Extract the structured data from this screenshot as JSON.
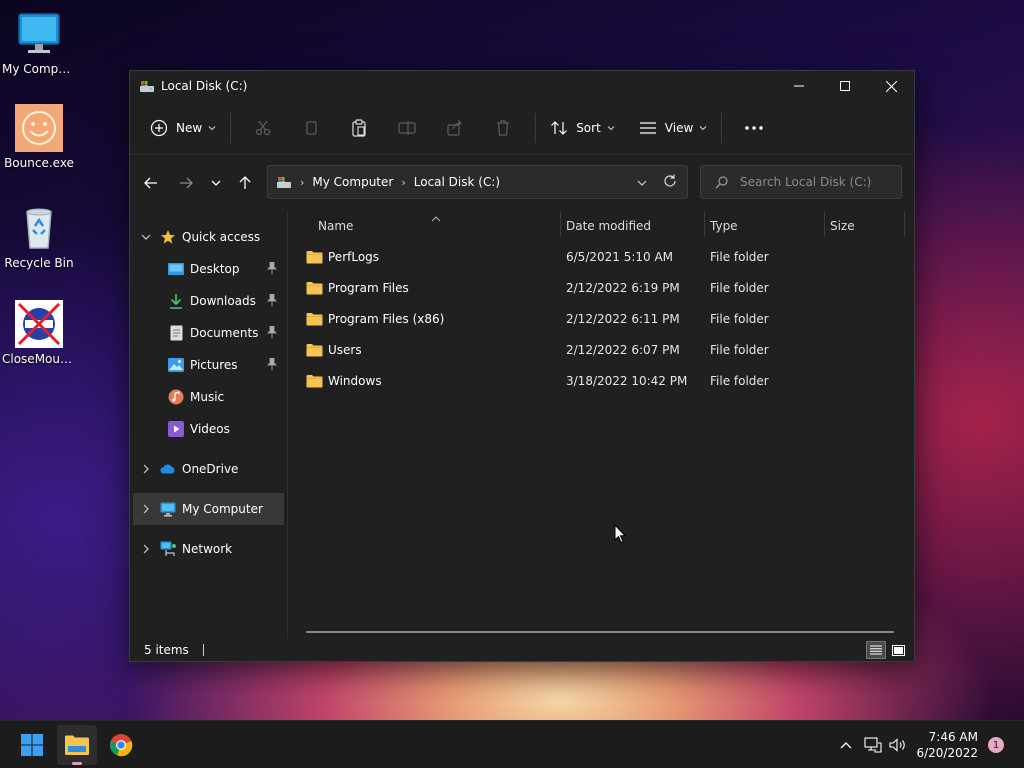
{
  "desktop": {
    "icons": [
      {
        "label": "My Computer",
        "icon": "monitor-icon"
      },
      {
        "label": "Bounce.exe",
        "icon": "smiley-icon"
      },
      {
        "label": "Recycle Bin",
        "icon": "recycle-bin-icon"
      },
      {
        "label": "CloseMouse...",
        "icon": "no-mouse-icon"
      }
    ]
  },
  "window": {
    "title": "Local Disk (C:)",
    "controls": {
      "minimize": "minimize-icon",
      "maximize": "maximize-icon",
      "close": "close-icon"
    }
  },
  "toolbar": {
    "new_label": "New",
    "sort_label": "Sort",
    "view_label": "View"
  },
  "address": {
    "crumbs": [
      "My Computer",
      "Local Disk (C:)"
    ]
  },
  "search": {
    "placeholder": "Search Local Disk (C:)"
  },
  "sidebar": {
    "quick_access": "Quick access",
    "quick_items": [
      {
        "label": "Desktop",
        "pinned": true
      },
      {
        "label": "Downloads",
        "pinned": true
      },
      {
        "label": "Documents",
        "pinned": true
      },
      {
        "label": "Pictures",
        "pinned": true
      },
      {
        "label": "Music",
        "pinned": false
      },
      {
        "label": "Videos",
        "pinned": false
      }
    ],
    "onedrive": "OneDrive",
    "my_computer": "My Computer",
    "network": "Network"
  },
  "columns": {
    "name": "Name",
    "date": "Date modified",
    "type": "Type",
    "size": "Size"
  },
  "files": [
    {
      "name": "PerfLogs",
      "date": "6/5/2021 5:10 AM",
      "type": "File folder"
    },
    {
      "name": "Program Files",
      "date": "2/12/2022 6:19 PM",
      "type": "File folder"
    },
    {
      "name": "Program Files (x86)",
      "date": "2/12/2022 6:11 PM",
      "type": "File folder"
    },
    {
      "name": "Users",
      "date": "2/12/2022 6:07 PM",
      "type": "File folder"
    },
    {
      "name": "Windows",
      "date": "3/18/2022 10:42 PM",
      "type": "File folder"
    }
  ],
  "status": {
    "item_count": "5 items"
  },
  "taskbar": {
    "time": "7:46 AM",
    "date": "6/20/2022",
    "notification_count": "1"
  },
  "colors": {
    "folder": "#f5c451",
    "accent": "#4cc2ff",
    "window_bg": "#202020"
  }
}
